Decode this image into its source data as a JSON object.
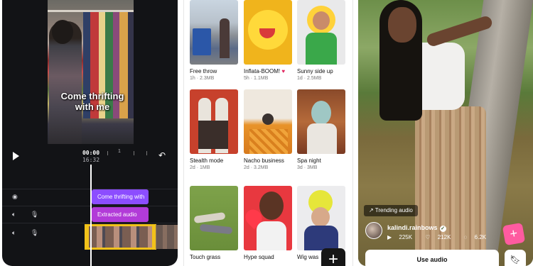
{
  "editor": {
    "caption": "Come thrifting with me",
    "timecode_current": "00:00",
    "timecode_total": "16:32",
    "marker_number": "1",
    "clip_text_label": "Come thrifting with",
    "clip_audio_label": "Extracted audio"
  },
  "library": {
    "tiles": [
      {
        "title": "Free throw",
        "meta": "1h · 2.3MB"
      },
      {
        "title": "Inflata-BOOM!",
        "meta": "5h · 1.1MB"
      },
      {
        "title": "Sunny side up",
        "meta": "1d · 2.5MB"
      },
      {
        "title": "Stealth mode",
        "meta": "2d · 1MB"
      },
      {
        "title": "Nacho business",
        "meta": "2d · 3.2MB"
      },
      {
        "title": "Spa night",
        "meta": "3d · 3MB"
      },
      {
        "title": "Touch grass",
        "meta": ""
      },
      {
        "title": "Hype squad",
        "meta": ""
      },
      {
        "title": "Wig was",
        "meta": ""
      }
    ],
    "add_button": "+"
  },
  "feed": {
    "trending_label": "Trending audio",
    "username": "kalindi.rainbows",
    "likes": "225K",
    "comments": "212K",
    "shares": "6.2K",
    "use_audio_label": "Use audio"
  },
  "colors": {
    "editor_bg": "#121316",
    "clip_text": "#8c4dff",
    "clip_audio": "#b23bd8",
    "selection": "#f2c21a",
    "sticker": "#ff5ba0"
  }
}
